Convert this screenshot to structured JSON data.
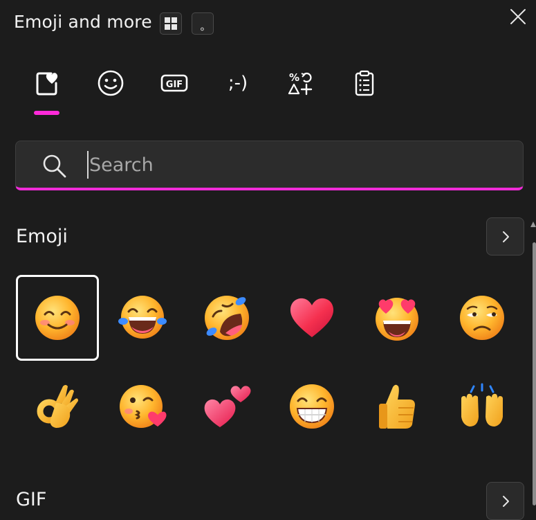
{
  "header": {
    "title": "Emoji and more",
    "windows_key_icon": "windows-logo-icon",
    "period_key_label": "。",
    "close_icon": "close-icon"
  },
  "tabs": [
    {
      "name": "favorites",
      "icon": "heart-card-icon",
      "selected": true
    },
    {
      "name": "emoji",
      "icon": "smiley-icon"
    },
    {
      "name": "gif",
      "icon": "gif-icon",
      "label": "GIF"
    },
    {
      "name": "kaomoji",
      "icon": "kaomoji-icon",
      "label": ";-)"
    },
    {
      "name": "symbols",
      "icon": "symbols-icon"
    },
    {
      "name": "clipboard",
      "icon": "clipboard-icon"
    }
  ],
  "search": {
    "placeholder": "Search",
    "value": ""
  },
  "sections": {
    "emoji_title": "Emoji",
    "gif_title": "GIF"
  },
  "emoji_grid": [
    {
      "name": "smiling-face-with-smiling-eyes",
      "selected": true
    },
    {
      "name": "face-with-tears-of-joy"
    },
    {
      "name": "rolling-on-the-floor-laughing"
    },
    {
      "name": "red-heart"
    },
    {
      "name": "smiling-face-with-heart-eyes"
    },
    {
      "name": "unamused-face"
    },
    {
      "name": "ok-hand"
    },
    {
      "name": "face-blowing-a-kiss"
    },
    {
      "name": "two-hearts"
    },
    {
      "name": "beaming-face-with-smiling-eyes"
    },
    {
      "name": "thumbs-up"
    },
    {
      "name": "raising-hands"
    }
  ],
  "colors": {
    "accent": "#ff2ad9",
    "background": "#1c1c1c",
    "search_bg": "#2c2c2c"
  }
}
